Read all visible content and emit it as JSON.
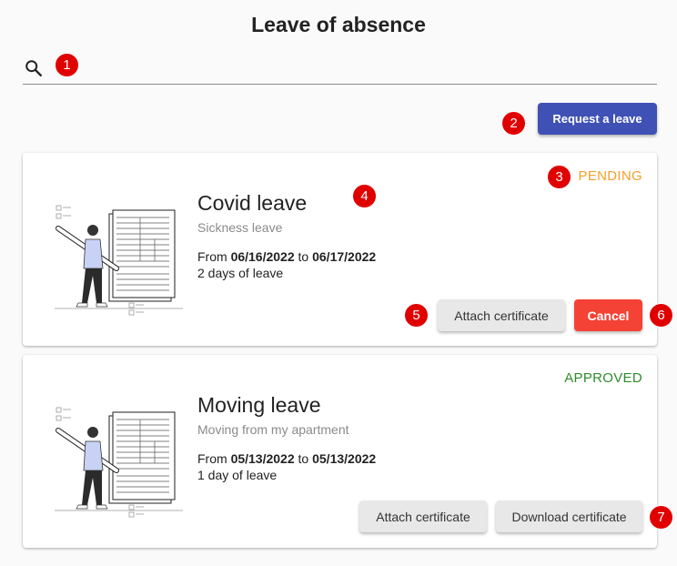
{
  "page": {
    "title": "Leave of absence"
  },
  "search": {
    "placeholder": "",
    "value": ""
  },
  "actions": {
    "request_label": "Request a leave"
  },
  "leaves": [
    {
      "status": "PENDING",
      "title": "Covid leave",
      "subtitle": "Sickness leave",
      "from_label": "From",
      "from_date": "06/16/2022",
      "to_label": "to",
      "to_date": "06/17/2022",
      "duration": "2 days of leave",
      "buttons": [
        "Attach certificate",
        "Cancel"
      ]
    },
    {
      "status": "APPROVED",
      "title": "Moving leave",
      "subtitle": "Moving from my apartment",
      "from_label": "From",
      "from_date": "05/13/2022",
      "to_label": "to",
      "to_date": "05/13/2022",
      "duration": "1 day of leave",
      "buttons": [
        "Attach certificate",
        "Download certificate"
      ]
    }
  ],
  "markers": [
    "1",
    "2",
    "3",
    "4",
    "5",
    "6",
    "7"
  ],
  "colors": {
    "primary": "#3f51b5",
    "danger": "#f44336",
    "pending": "#f4a02a",
    "approved": "#2e8b2e",
    "marker": "#e00000"
  },
  "icons": {
    "search": "search-icon",
    "illustration": "person-with-pencil-and-form-illustration"
  }
}
